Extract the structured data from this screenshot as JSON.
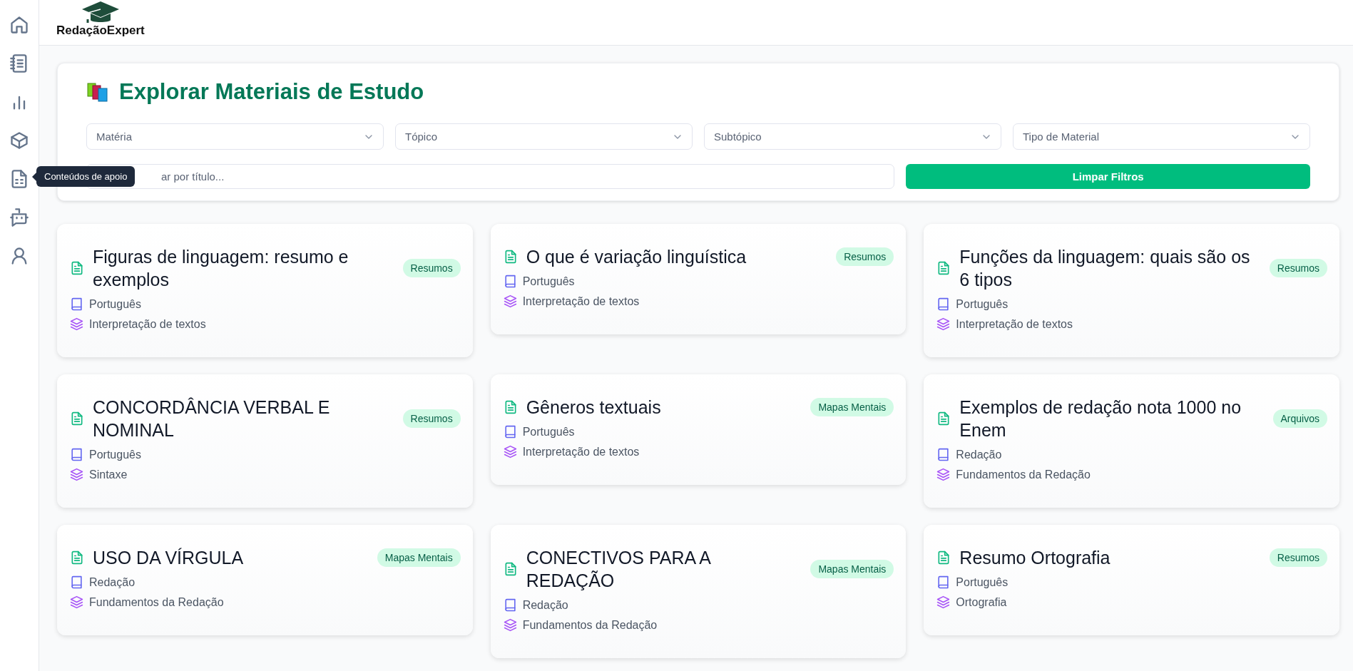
{
  "sidebar": {
    "items": [
      {
        "kind": "home"
      },
      {
        "kind": "notebook"
      },
      {
        "kind": "chart"
      },
      {
        "kind": "box"
      },
      {
        "kind": "document"
      },
      {
        "kind": "bot"
      },
      {
        "kind": "user"
      }
    ],
    "tooltip": "Conteúdos de apoio"
  },
  "header": {
    "logo": "RedaçãoExpert"
  },
  "filters": {
    "title": "Explorar Materiais de Estudo",
    "selects": [
      {
        "placeholder": "Matéria"
      },
      {
        "placeholder": "Tópico"
      },
      {
        "placeholder": "Subtópico"
      },
      {
        "placeholder": "Tipo de Material"
      }
    ],
    "search": {
      "placeholder": "ar por título..."
    },
    "clear_button": "Limpar Filtros"
  },
  "materials": [
    {
      "title": "Figuras de linguagem: resumo e exemplos",
      "badge": "Resumos",
      "subject": "Português",
      "topic": "Interpretação de textos"
    },
    {
      "title": "O que é variação linguística",
      "badge": "Resumos",
      "subject": "Português",
      "topic": "Interpretação de textos"
    },
    {
      "title": "Funções da linguagem: quais são os 6 tipos",
      "badge": "Resumos",
      "subject": "Português",
      "topic": "Interpretação de textos"
    },
    {
      "title": "CONCORDÂNCIA VERBAL E NOMINAL",
      "badge": "Resumos",
      "subject": "Português",
      "topic": "Sintaxe"
    },
    {
      "title": "Gêneros textuais",
      "badge": "Mapas Mentais",
      "subject": "Português",
      "topic": "Interpretação de textos"
    },
    {
      "title": "Exemplos de redação nota 1000 no Enem",
      "badge": "Arquivos",
      "subject": "Redação",
      "topic": "Fundamentos da Redação"
    },
    {
      "title": "USO DA VÍRGULA",
      "badge": "Mapas Mentais",
      "subject": "Redação",
      "topic": "Fundamentos da Redação"
    },
    {
      "title": "CONECTIVOS PARA A REDAÇÃO",
      "badge": "Mapas Mentais",
      "subject": "Redação",
      "topic": "Fundamentos da Redação"
    },
    {
      "title": "Resumo Ortografia",
      "badge": "Resumos",
      "subject": "Português",
      "topic": "Ortografia"
    }
  ]
}
